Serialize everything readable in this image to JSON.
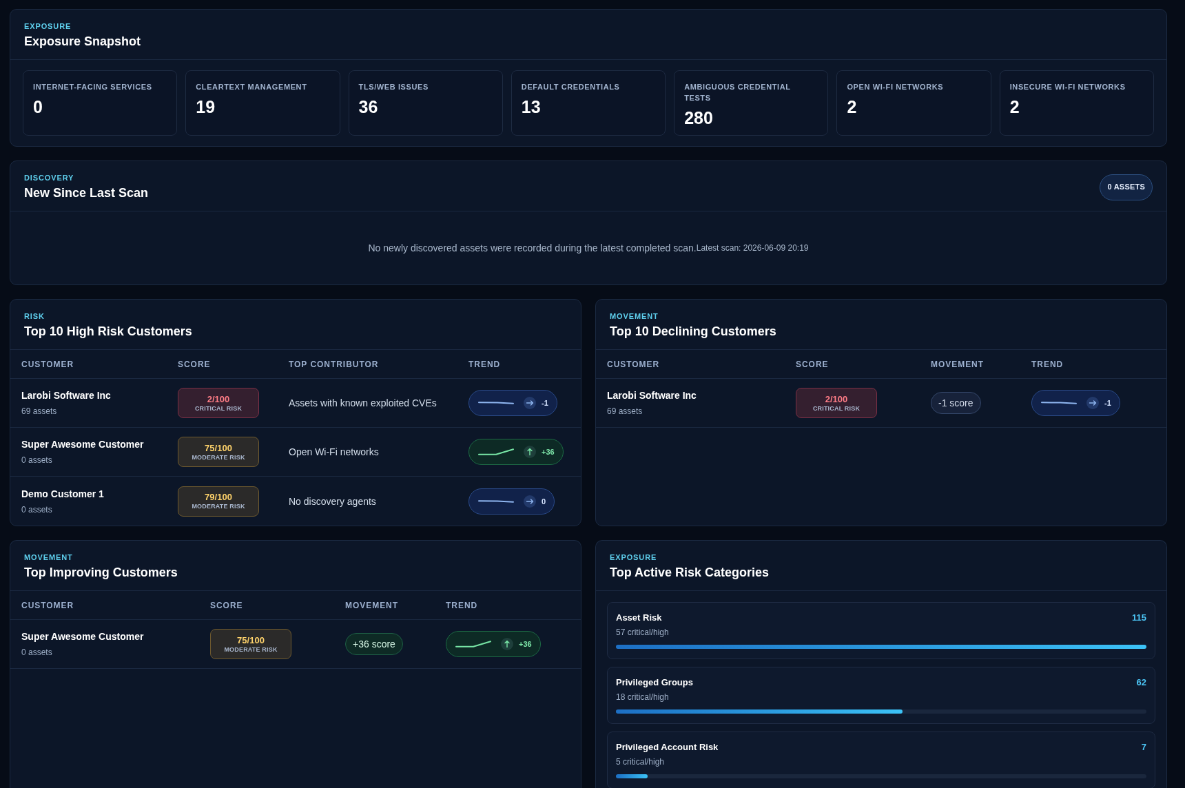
{
  "panels": [
    {
      "kind": "metrics",
      "eyebrow": "EXPOSURE",
      "title": "Exposure Snapshot",
      "metrics": [
        {
          "label": "INTERNET-FACING SERVICES",
          "value": "0"
        },
        {
          "label": "CLEARTEXT MANAGEMENT",
          "value": "19"
        },
        {
          "label": "TLS/WEB ISSUES",
          "value": "36"
        },
        {
          "label": "DEFAULT CREDENTIALS",
          "value": "13"
        },
        {
          "label": "AMBIGUOUS CREDENTIAL TESTS",
          "value": "280"
        },
        {
          "label": "OPEN WI-FI NETWORKS",
          "value": "2"
        },
        {
          "label": "INSECURE WI-FI NETWORKS",
          "value": "2"
        }
      ]
    },
    {
      "kind": "notice",
      "eyebrow": "DISCOVERY",
      "title": "New Since Last Scan",
      "count": "0 ASSETS",
      "message": "No newly discovered assets were recorded during the latest completed scan.",
      "note": "Latest scan: 2026-06-09 20:19"
    },
    {
      "kind": "table",
      "eyebrow": "RISK",
      "title": "Top 10 High Risk Customers",
      "columns": [
        {
          "label": "CUSTOMER",
          "kind": "customer"
        },
        {
          "label": "SCORE",
          "kind": "score"
        },
        {
          "label": "TOP CONTRIBUTOR",
          "kind": "contributor"
        },
        {
          "label": "TREND",
          "kind": "trend"
        }
      ],
      "rows": [
        {
          "customer": "Larobi Software Inc",
          "assets": "69 assets",
          "score": {
            "kind": "critical",
            "value": "2/100",
            "label": "CRITICAL RISK"
          },
          "contributor": "Assets with known exploited CVEs",
          "trend": {
            "kind": "flat",
            "delta": "-1"
          }
        },
        {
          "customer": "Super Awesome Customer",
          "assets": "0 assets",
          "score": {
            "kind": "moderate",
            "value": "75/100",
            "label": "MODERATE RISK"
          },
          "contributor": "Open Wi-Fi networks",
          "trend": {
            "kind": "up",
            "delta": "+36"
          }
        },
        {
          "customer": "Demo Customer 1",
          "assets": "0 assets",
          "score": {
            "kind": "moderate",
            "value": "79/100",
            "label": "MODERATE RISK"
          },
          "contributor": "No discovery agents",
          "trend": {
            "kind": "flat",
            "delta": "0"
          }
        }
      ]
    },
    {
      "kind": "table",
      "eyebrow": "MOVEMENT",
      "title": "Top 10 Declining Customers",
      "columns": [
        {
          "label": "CUSTOMER",
          "kind": "customer"
        },
        {
          "label": "SCORE",
          "kind": "score"
        },
        {
          "label": "MOVEMENT",
          "kind": "movement"
        },
        {
          "label": "TREND",
          "kind": "trend"
        }
      ],
      "rows": [
        {
          "customer": "Larobi Software Inc",
          "assets": "69 assets",
          "score": {
            "kind": "critical",
            "value": "2/100",
            "label": "CRITICAL RISK"
          },
          "movement": {
            "kind": "neutral",
            "text": "-1 score"
          },
          "trend": {
            "kind": "flat",
            "delta": "-1"
          }
        }
      ]
    },
    {
      "kind": "table",
      "eyebrow": "MOVEMENT",
      "title": "Top Improving Customers",
      "columns": [
        {
          "label": "CUSTOMER",
          "kind": "customer"
        },
        {
          "label": "SCORE",
          "kind": "score"
        },
        {
          "label": "MOVEMENT",
          "kind": "movement"
        },
        {
          "label": "TREND",
          "kind": "trend"
        }
      ],
      "rows": [
        {
          "customer": "Super Awesome Customer",
          "assets": "0 assets",
          "score": {
            "kind": "moderate",
            "value": "75/100",
            "label": "MODERATE RISK"
          },
          "movement": {
            "kind": "positive",
            "text": "+36 score"
          },
          "trend": {
            "kind": "up",
            "delta": "+36"
          }
        }
      ]
    },
    {
      "kind": "categories",
      "eyebrow": "EXPOSURE",
      "title": "Top Active Risk Categories",
      "categories": [
        {
          "name": "Asset Risk",
          "count": "115",
          "detail": "57 critical/high",
          "level": 1.0
        },
        {
          "name": "Privileged Groups",
          "count": "62",
          "detail": "18 critical/high",
          "level": 0.54
        },
        {
          "name": "Privileged Account Risk",
          "count": "7",
          "detail": "5 critical/high",
          "level": 0.06
        }
      ]
    }
  ]
}
